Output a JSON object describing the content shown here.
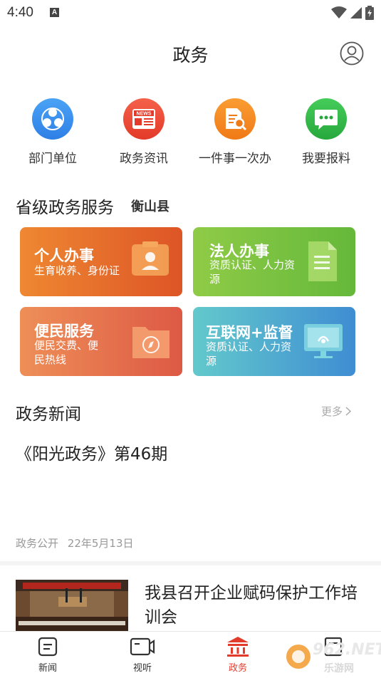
{
  "status_bar": {
    "time": "4:40",
    "notification_icon": "A"
  },
  "header": {
    "title": "政务",
    "user_icon": "user-circle-icon"
  },
  "quick_links": [
    {
      "label": "部门单位",
      "icon": "departments-icon",
      "color": "#3b8ff0"
    },
    {
      "label": "政务资讯",
      "icon": "news-icon",
      "color": "#ef4b36"
    },
    {
      "label": "一件事一次办",
      "icon": "document-search-icon",
      "color": "#f5871f"
    },
    {
      "label": "我要报料",
      "icon": "chat-icon",
      "color": "#2fb84a"
    }
  ],
  "services_section": {
    "title": "省级政务服务",
    "region": "衡山县"
  },
  "service_cards": [
    {
      "title": "个人办事",
      "desc": "生育收养、身份证",
      "icon": "id-card-icon",
      "gradient_from": "#ee8431",
      "gradient_to": "#e05a28"
    },
    {
      "title": "法人办事",
      "desc": "资质认证、人力资源",
      "icon": "document-icon",
      "gradient_from": "#8bc945",
      "gradient_to": "#66b93b"
    },
    {
      "title": "便民服务",
      "desc": "便民交费、便民热线",
      "icon": "folder-compass-icon",
      "gradient_from": "#ee8a52",
      "gradient_to": "#e05c48"
    },
    {
      "title": "互联网+监督",
      "desc": "资质认证、人力资源",
      "icon": "monitor-icon",
      "gradient_from": "#5fc6cc",
      "gradient_to": "#3f8fd0"
    }
  ],
  "news_section": {
    "title": "政务新闻",
    "more_label": "更多"
  },
  "featured_article": {
    "title": "《阳光政务》第46期",
    "source": "政务公开",
    "date": "22年5月13日"
  },
  "news_items": [
    {
      "title": "我县召开企业赋码保护工作培训会"
    }
  ],
  "tabbar": [
    {
      "label": "新闻",
      "icon": "news-tab-icon",
      "active": false
    },
    {
      "label": "视听",
      "icon": "video-tab-icon",
      "active": false
    },
    {
      "label": "政务",
      "icon": "government-tab-icon",
      "active": true
    },
    {
      "label": "",
      "icon": "service-tab-icon",
      "active": false
    }
  ],
  "watermark": {
    "brand": "962.NET",
    "site": "乐游网"
  },
  "colors": {
    "accent": "#e23b2c",
    "text": "#222222",
    "muted": "#999999"
  }
}
